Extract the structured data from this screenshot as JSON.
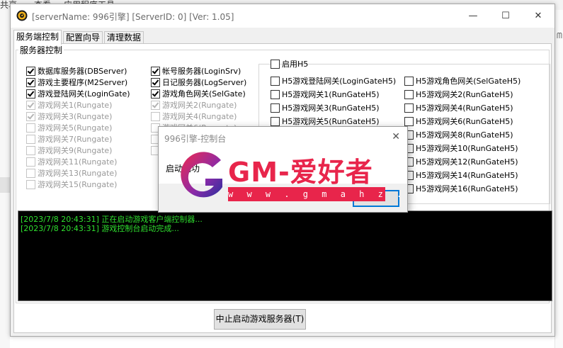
{
  "background_app": {
    "menu_items": [
      "共享",
      "查看",
      "应用程序工具"
    ]
  },
  "window": {
    "title": "[serverName: 996引擎] [ServerID: 0] [Ver:  1.05]",
    "controls": {
      "minimize": "—",
      "maximize": "☐",
      "close": "✕"
    }
  },
  "tabs": [
    {
      "label": "服务端控制",
      "active": true
    },
    {
      "label": "配置向导",
      "active": false
    },
    {
      "label": "清理数据",
      "active": false
    }
  ],
  "server_control": {
    "group_title": "服务器控制",
    "column1": [
      {
        "label": "数据库服务器(DBServer)",
        "checked": true,
        "enabled": true
      },
      {
        "label": "游戏主要程序(M2Server)",
        "checked": true,
        "enabled": true
      },
      {
        "label": "游戏登陆网关(LoginGate)",
        "checked": true,
        "enabled": true
      },
      {
        "label": "游戏网关1(Rungate)",
        "checked": true,
        "enabled": false
      },
      {
        "label": "游戏网关3(Rungate)",
        "checked": true,
        "enabled": false
      },
      {
        "label": "游戏网关5(Rungate)",
        "checked": false,
        "enabled": false
      },
      {
        "label": "游戏网关7(Rungate)",
        "checked": false,
        "enabled": false
      },
      {
        "label": "游戏网关9(Rungate)",
        "checked": false,
        "enabled": false
      },
      {
        "label": "游戏网关11(Rungate)",
        "checked": false,
        "enabled": false
      },
      {
        "label": "游戏网关13(Rungate)",
        "checked": false,
        "enabled": false
      },
      {
        "label": "游戏网关15(Rungate)",
        "checked": false,
        "enabled": false
      }
    ],
    "column2": [
      {
        "label": "帐号服务器(LoginSrv)",
        "checked": true,
        "enabled": true
      },
      {
        "label": "日记服务器(LogServer)",
        "checked": true,
        "enabled": true
      },
      {
        "label": "游戏角色网关(SelGate)",
        "checked": true,
        "enabled": true
      },
      {
        "label": "游戏网关2(Rungate)",
        "checked": true,
        "enabled": false
      },
      {
        "label": "游戏网关4(Rungate)",
        "checked": false,
        "enabled": false
      },
      {
        "label": "游戏网关6(Rungate)",
        "checked": false,
        "enabled": false
      }
    ]
  },
  "h5": {
    "enable_label": "启用H5",
    "enable_checked": false,
    "column1": [
      "H5游戏登陆网关(LoginGateH5)",
      "H5游戏网关1(RunGateH5)",
      "H5游戏网关3(RunGateH5)",
      "H5游戏网关5(RunGateH5)"
    ],
    "column2": [
      "H5游戏角色网关(SelGateH5)",
      "H5游戏网关2(RunGateH5)",
      "H5游戏网关4(RunGateH5)",
      "H5游戏网关6(RunGateH5)",
      "H5游戏网关8(RunGateH5)",
      "H5游戏网关10(RunGateH5)",
      "H5游戏网关12(RunGateH5)",
      "H5游戏网关14(RunGateH5)",
      "H5游戏网关16(RunGateH5)"
    ]
  },
  "console": {
    "lines": [
      "[2023/7/8 20:43:31] 正在启动游戏客户端控制器...",
      "[2023/7/8 20:43:31] 游戏控制台启动完成..."
    ]
  },
  "stop_button": "中止启动游戏服务器(T)",
  "dialog": {
    "title": "996引擎-控制台",
    "message": "启动成功",
    "ok_label": "OK",
    "close": "✕"
  },
  "watermark": {
    "text": "GM-爱好者",
    "url": "w w w . g m a h z . c o m"
  },
  "colors": {
    "console_text": "#2fe02f",
    "console_bg": "#000000",
    "watermark": "#e8254b",
    "accent": "#0078d7"
  }
}
